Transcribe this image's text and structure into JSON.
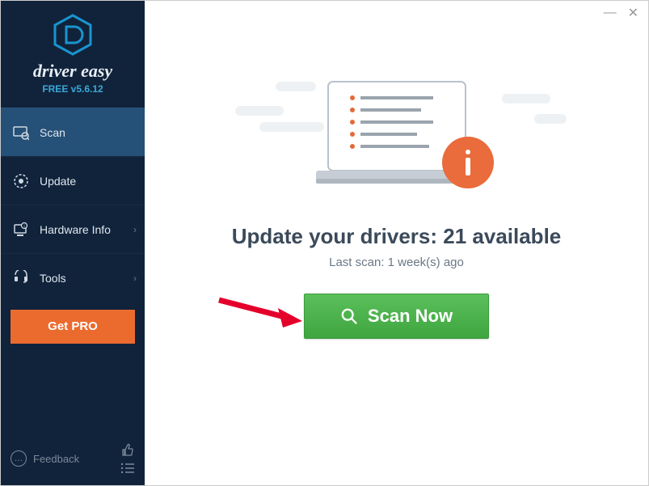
{
  "app": {
    "brand": "driver easy",
    "version": "FREE v5.6.12"
  },
  "window": {
    "minimize": "—",
    "close": "✕"
  },
  "sidebar": {
    "items": [
      {
        "label": "Scan"
      },
      {
        "label": "Update"
      },
      {
        "label": "Hardware Info"
      },
      {
        "label": "Tools"
      }
    ],
    "getPro": "Get PRO",
    "feedback": "Feedback"
  },
  "main": {
    "headline_prefix": "Update your drivers: ",
    "headline_count": "21",
    "headline_suffix": " available",
    "lastScan": "Last scan: 1 week(s) ago",
    "scanBtn": "Scan Now"
  }
}
